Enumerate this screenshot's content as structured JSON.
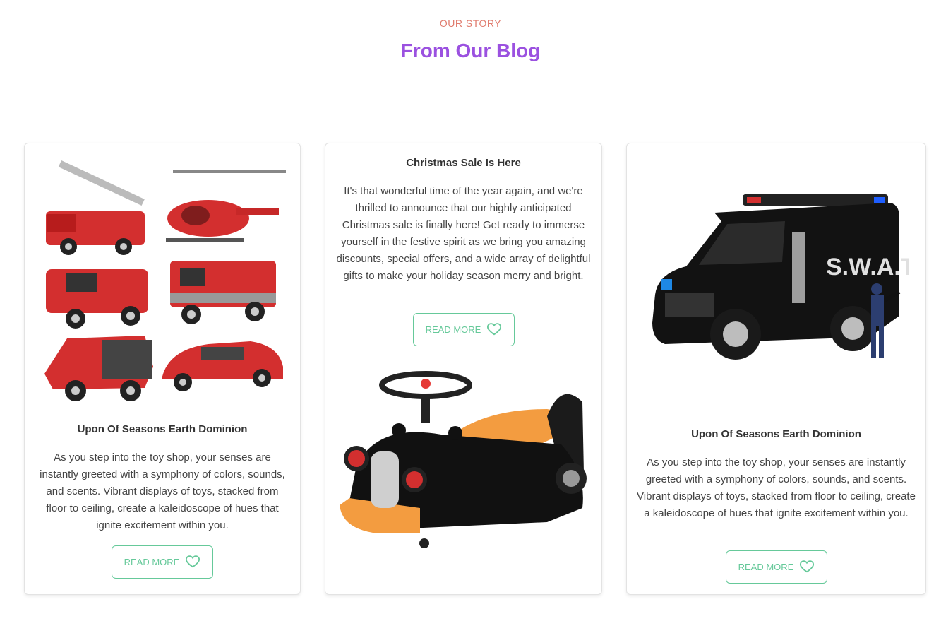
{
  "section": {
    "eyebrow": "OUR STORY",
    "heading": "From Our Blog"
  },
  "colors": {
    "eyebrow": "#e07b6d",
    "heading": "#9b51e0",
    "button": "#66c99a"
  },
  "posts": [
    {
      "image": "toy-fire-vehicles-set-image",
      "title": "Upon Of Seasons Earth Dominion",
      "text": "As you step into the toy shop, your senses are instantly greeted with a symphony of colors, sounds, and scents. Vibrant displays of toys, stacked from floor to ceiling, create a kaleidoscope of hues that ignite excitement within you.",
      "button": "READ MORE",
      "button_icon": "heart-icon"
    },
    {
      "image": "ride-on-toy-car-image",
      "title": "Christmas Sale Is Here",
      "text": "It's that wonderful time of the year again, and we're thrilled to announce that our highly anticipated Christmas sale is finally here! Get ready to immerse yourself in the festive spirit as we bring you amazing discounts, special offers, and a wide array of delightful gifts to make your holiday season merry and bright.",
      "button": "READ MORE",
      "button_icon": "heart-icon"
    },
    {
      "image": "swat-truck-toy-image",
      "image_label": "S.W.A.T.",
      "title": "Upon Of Seasons Earth Dominion",
      "text": "As you step into the toy shop, your senses are instantly greeted with a symphony of colors, sounds, and scents. Vibrant displays of toys, stacked from floor to ceiling, create a kaleidoscope of hues that ignite excitement within you.",
      "button": "READ MORE",
      "button_icon": "heart-icon"
    }
  ]
}
